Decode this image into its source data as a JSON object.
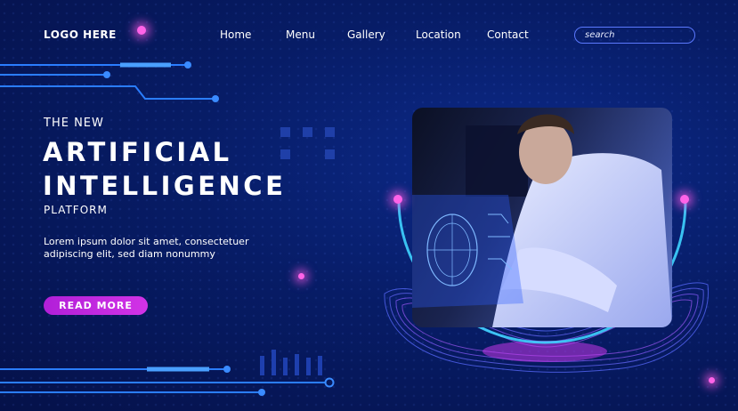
{
  "header": {
    "logo": "LOGO HERE",
    "nav": [
      "Home",
      "Menu",
      "Gallery",
      "Location",
      "Contact"
    ],
    "search_placeholder": "search"
  },
  "hero": {
    "eyebrow": "THE NEW",
    "title_line1": "ARTIFICIAL",
    "title_line2": "INTELLIGENCE",
    "subtitle": "PLATFORM",
    "body": "Lorem ipsum dolor sit amet, consectetuer adipiscing elit, sed diam nonummy",
    "cta": "READ MORE"
  },
  "colors": {
    "background": "#071c66",
    "accent_magenta": "#c928e0",
    "circuit_blue": "#2a7dff",
    "search_border": "#5b79ff"
  },
  "icons": [
    "search-field",
    "circuit-lines",
    "glow-dot",
    "hologram-face",
    "wave-platform"
  ]
}
